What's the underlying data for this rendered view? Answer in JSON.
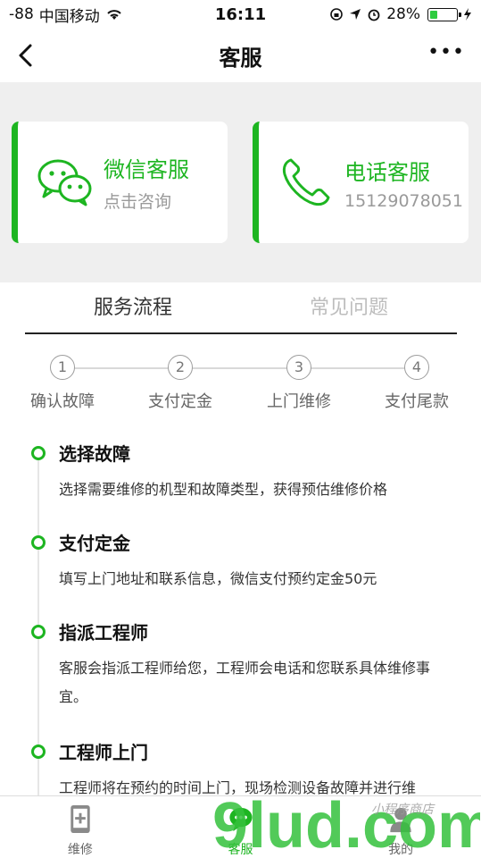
{
  "status_bar": {
    "signal": "-88",
    "carrier": "中国移动",
    "time": "16:11",
    "battery": "28%"
  },
  "navbar": {
    "title": "客服",
    "more": "•••"
  },
  "contact_cards": [
    {
      "title": "微信客服",
      "subtitle": "点击咨询",
      "icon": "wechat-icon"
    },
    {
      "title": "电话客服",
      "subtitle": "15129078051",
      "icon": "phone-icon"
    }
  ],
  "tabs": [
    {
      "label": "服务流程",
      "active": true
    },
    {
      "label": "常见问题",
      "active": false
    }
  ],
  "steps": [
    {
      "num": "1",
      "label": "确认故障"
    },
    {
      "num": "2",
      "label": "支付定金"
    },
    {
      "num": "3",
      "label": "上门维修"
    },
    {
      "num": "4",
      "label": "支付尾款"
    }
  ],
  "timeline": [
    {
      "title": "选择故障",
      "desc": "选择需要维修的机型和故障类型，获得预估维修价格"
    },
    {
      "title": "支付定金",
      "desc": "填写上门地址和联系信息，微信支付预约定金50元"
    },
    {
      "title": "指派工程师",
      "desc": "客服会指派工程师给您，工程师会电话和您联系具体维修事宜。"
    },
    {
      "title": "工程师上门",
      "desc": "工程师将在预约的时间上门，现场检测设备故障并进行维"
    }
  ],
  "bottom_tabs": [
    {
      "label": "维修",
      "active": false,
      "icon": "phone-repair-icon"
    },
    {
      "label": "客服",
      "active": true,
      "icon": "chat-icon"
    },
    {
      "label": "我的",
      "active": false,
      "icon": "user-icon"
    }
  ],
  "watermark": {
    "text": "9lud.com",
    "subtext": "小程序商店"
  },
  "colors": {
    "accent": "#1db521",
    "background": "#efefef"
  }
}
